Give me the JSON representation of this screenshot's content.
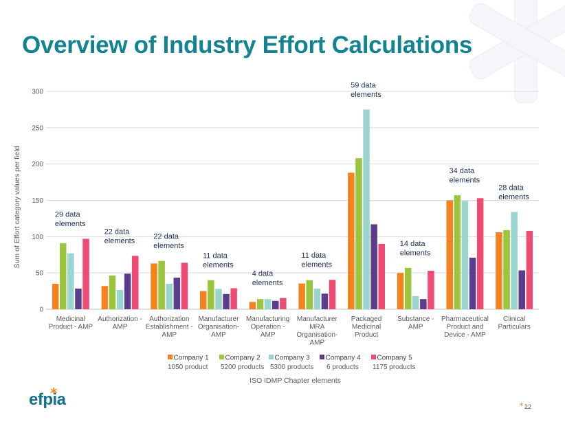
{
  "slide": {
    "title": "Overview of Industry Effort Calculations",
    "logo_text": "efpia",
    "logo_star": "*",
    "page_number": "22",
    "page_star": "*"
  },
  "colors": {
    "title": "#12838F",
    "company1": "#F58220",
    "company2": "#9BC53D",
    "company3": "#9AD6CF",
    "company4": "#5C3D8C",
    "company5": "#EE4C72"
  },
  "chart_data": {
    "type": "bar",
    "title": "",
    "xlabel": "ISO IDMP Chapter elements",
    "ylabel": "Sum of Effort category values per field",
    "ylim": [
      0,
      300
    ],
    "yticks": [
      0,
      50,
      100,
      150,
      200,
      250,
      300
    ],
    "grid": true,
    "legend_position": "bottom",
    "categories": [
      [
        "Medicinal",
        "Product - AMP"
      ],
      [
        "Authorization -",
        "AMP"
      ],
      [
        "Authorization",
        "Establishment -",
        "AMP"
      ],
      [
        "Manufacturer",
        "Organisation-",
        "AMP"
      ],
      [
        "Manufacturing",
        "Operation -",
        "AMP"
      ],
      [
        "Manufacturer",
        "MRA",
        "Organisation-",
        "AMP"
      ],
      [
        "Packaged",
        "Medicinal",
        "Product"
      ],
      [
        "Substance -",
        "AMP"
      ],
      [
        "Pharmaceutical",
        "Product and",
        "Device - AMP"
      ],
      [
        "Clinical",
        "Particulars"
      ]
    ],
    "annotations": [
      [
        "29 data",
        "elements"
      ],
      [
        "22 data",
        "elements"
      ],
      [
        "22 data",
        "elements"
      ],
      [
        "11 data",
        "elements"
      ],
      [
        "4 data",
        "elements"
      ],
      [
        "11 data",
        "elements"
      ],
      [
        "59 data",
        "elements"
      ],
      [
        "14 data",
        "elements"
      ],
      [
        "34 data",
        "elements"
      ],
      [
        "28 data",
        "elements"
      ]
    ],
    "series": [
      {
        "name": "Company 1",
        "subtitle": "1050 product",
        "color": "#F58220",
        "values": [
          35,
          32,
          63,
          25,
          10,
          35.5,
          188,
          50,
          150,
          106
        ]
      },
      {
        "name": "Company 2",
        "subtitle": "5200 products",
        "color": "#9BC53D",
        "values": [
          91,
          46.5,
          66.5,
          40,
          14,
          40,
          208,
          57,
          157,
          109
        ]
      },
      {
        "name": "Company 3",
        "subtitle": "5300 products",
        "color": "#9AD6CF",
        "values": [
          77,
          26.5,
          35,
          28,
          14,
          28.5,
          275,
          18,
          149,
          134
        ]
      },
      {
        "name": "Company 4",
        "subtitle": "6 products",
        "color": "#5C3D8C",
        "values": [
          28.5,
          49,
          43.5,
          21,
          11.5,
          21.5,
          117,
          14,
          71,
          53.5
        ]
      },
      {
        "name": "Company 5",
        "subtitle": "1175 products",
        "color": "#EE4C72",
        "values": [
          97,
          73.5,
          64,
          29,
          15.5,
          40.5,
          90,
          53,
          153,
          108
        ]
      }
    ]
  }
}
